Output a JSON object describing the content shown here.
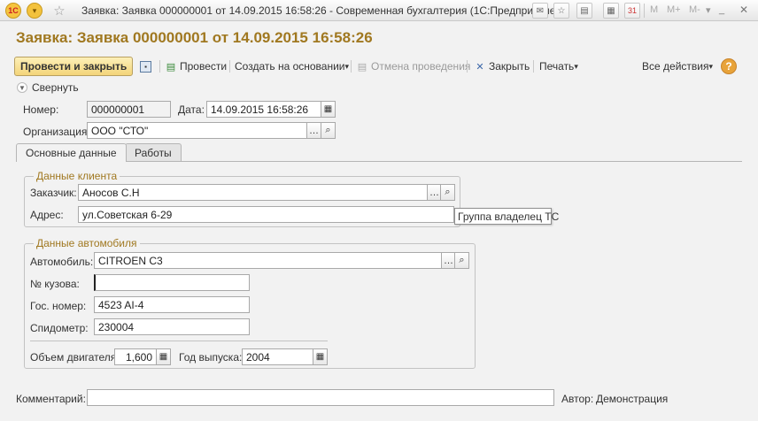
{
  "window": {
    "title": "Заявка: Заявка 000000001 от 14.09.2015 16:58:26 - Современная бухгалтерия  (1С:Предприятие)",
    "logo": "1С",
    "memory_buttons": [
      "M",
      "M+",
      "M-"
    ]
  },
  "form": {
    "title": "Заявка: Заявка 000000001 от 14.09.2015 16:58:26"
  },
  "toolbar": {
    "post_close": "Провести и закрыть",
    "post": "Провести",
    "create_based": "Создать на основании",
    "cancel_posting": "Отмена проведения",
    "close": "Закрыть",
    "print": "Печать",
    "all_actions": "Все действия",
    "help": "?"
  },
  "collapse_label": "Свернуть",
  "header": {
    "number_label": "Номер:",
    "number_value": "000000001",
    "date_label": "Дата:",
    "date_value": "14.09.2015 16:58:26",
    "org_label": "Организация:",
    "org_value": "ООО \"СТО\""
  },
  "tabs": [
    {
      "label": "Основные данные",
      "active": true
    },
    {
      "label": "Работы",
      "active": false
    }
  ],
  "client": {
    "group_title": "Данные клиента",
    "customer_label": "Заказчик:",
    "customer_value": "Аносов С.Н",
    "address_label": "Адрес:",
    "address_value": "ул.Советская 6-29",
    "tooltip": "Группа владелец ТС"
  },
  "vehicle": {
    "group_title": "Данные автомобиля",
    "car_label": "Автомобиль:",
    "car_value": "CITROEN C3",
    "body_label": "№ кузова:",
    "body_value": "",
    "plate_label": "Гос. номер:",
    "plate_value": "4523 AI-4",
    "odometer_label": "Спидометр:",
    "odometer_value": "230004",
    "engine_label": "Объем двигателя:",
    "engine_value": "1,600",
    "year_label": "Год выпуска:",
    "year_value": "2004"
  },
  "footer": {
    "comment_label": "Комментарий:",
    "comment_value": "",
    "author_label": "Автор:",
    "author_value": "Демонстрация"
  }
}
